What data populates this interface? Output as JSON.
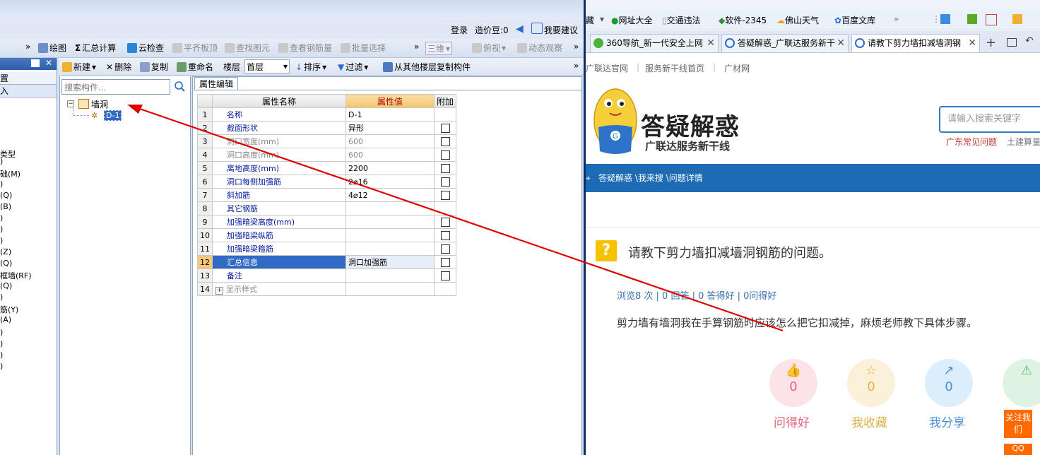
{
  "app": {
    "userbar": {
      "login": "登录",
      "price_beans": "造价豆:0",
      "feedback": "我要建议"
    },
    "toolbar1": {
      "draw": "绘图",
      "summary": "汇总计算",
      "cloud_check": "云检查",
      "flush_board": "平齐板顶",
      "find_element": "查找图元",
      "view_rebar": "查看钢筋量",
      "batch_select": "批量选择",
      "view_3d": "三维",
      "top_view": "俯视",
      "dynamic_observe": "动态观察",
      "more": "»"
    },
    "left_panel": {
      "items": [
        "置",
        "入",
        "类型",
        ")",
        "础(M)",
        ")",
        "(Q)",
        "(B)",
        ")",
        ")",
        ")",
        "(Z)",
        "(Q)",
        "框墙(RF)",
        "(Q)",
        ")",
        "筋(Y)",
        "(A)",
        ")",
        ")",
        ")",
        ")"
      ]
    },
    "toolbar2": {
      "new": "新建",
      "delete": "删除",
      "copy": "复制",
      "rename": "重命名",
      "floor_label": "楼层",
      "floor_value": "首层",
      "sort": "排序",
      "filter": "过滤",
      "copy_from_other_floor": "从其他楼层复制构件"
    },
    "tree": {
      "search_placeholder": "搜索构件...",
      "root": "墙洞",
      "child": "D-1"
    },
    "property_panel": {
      "tab": "属性编辑",
      "headers": {
        "name": "属性名称",
        "value": "属性值",
        "extra": "附加"
      },
      "rows": [
        {
          "no": "1",
          "name": "名称",
          "value": "D-1",
          "has_check": false,
          "gray": false
        },
        {
          "no": "2",
          "name": "截面形状",
          "value": "异形",
          "has_check": true,
          "gray": false
        },
        {
          "no": "3",
          "name": "洞口宽度(mm)",
          "value": "600",
          "has_check": true,
          "gray": true
        },
        {
          "no": "4",
          "name": "洞口高度(mm)",
          "value": "600",
          "has_check": true,
          "gray": true
        },
        {
          "no": "5",
          "name": "离地高度(mm)",
          "value": "2200",
          "has_check": true,
          "gray": false
        },
        {
          "no": "6",
          "name": "洞口每侧加强筋",
          "value": "2⌀16",
          "has_check": true,
          "gray": false
        },
        {
          "no": "7",
          "name": "斜加筋",
          "value": "4⌀12",
          "has_check": true,
          "gray": false
        },
        {
          "no": "8",
          "name": "其它钢筋",
          "value": "",
          "has_check": false,
          "gray": false
        },
        {
          "no": "9",
          "name": "加强暗梁高度(mm)",
          "value": "",
          "has_check": true,
          "gray": false
        },
        {
          "no": "10",
          "name": "加强暗梁纵筋",
          "value": "",
          "has_check": true,
          "gray": false
        },
        {
          "no": "11",
          "name": "加强暗梁箍筋",
          "value": "",
          "has_check": true,
          "gray": false
        },
        {
          "no": "12",
          "name": "汇总信息",
          "value": "洞口加强筋",
          "has_check": true,
          "gray": false
        },
        {
          "no": "13",
          "name": "备注",
          "value": "",
          "has_check": true,
          "gray": false
        },
        {
          "no": "14",
          "name": "显示样式",
          "value": "",
          "has_check": false,
          "gray": true
        }
      ],
      "selected_row": "12"
    }
  },
  "browser": {
    "favorites": [
      "藏",
      "网址大全",
      "交通违法",
      "软件-2345",
      "佛山天气",
      "百度文库"
    ],
    "tabs": [
      {
        "title": "360导航_新一代安全上网",
        "active": false
      },
      {
        "title": "答疑解惑_广联达服务新干",
        "active": false
      },
      {
        "title": "请教下剪力墙扣减墙洞钢",
        "active": true
      }
    ],
    "nav_links": [
      "广联达官网",
      "服务新干线首页",
      "广材网"
    ],
    "site": {
      "title": "答疑解惑",
      "subtitle": "广联达服务新干线",
      "search_placeholder": "请输入搜索关键字",
      "links": [
        "广东常见问题",
        "土建算量"
      ],
      "breadcrumb": "答疑解惑 \\我来搜 \\问题详情"
    },
    "question": {
      "title": "请教下剪力墙扣减墙洞钢筋的问题。",
      "stats": "浏览8 次 | 0 回答 | 0 答得好 | 0问得好",
      "body": "剪力墙有墙洞我在手算钢筋时应该怎么把它扣减掉，麻烦老师教下具体步骤。"
    },
    "actions": [
      {
        "label": "问得好",
        "count": "0",
        "color": "#e5637a"
      },
      {
        "label": "我收藏",
        "count": "0",
        "color": "#e0b34a"
      },
      {
        "label": "我分享",
        "count": "0",
        "color": "#4a8fd0"
      },
      {
        "label": "举报",
        "count": "",
        "color": "#5bb56a"
      }
    ],
    "follow": "关注我们",
    "qq": "QQ"
  },
  "annotation": {
    "color": "#e00000"
  }
}
